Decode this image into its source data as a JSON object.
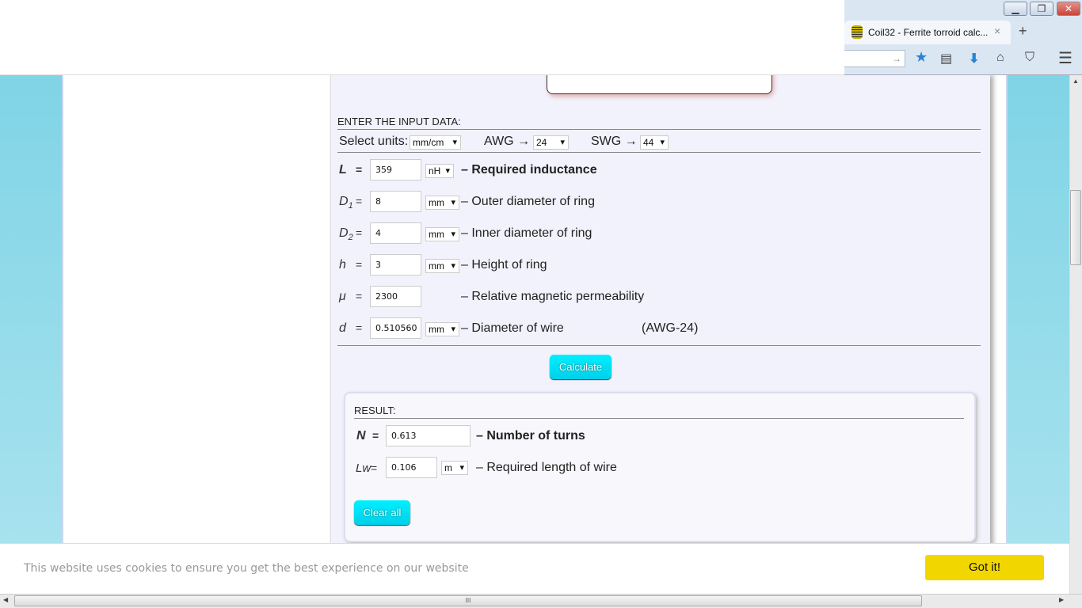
{
  "browser": {
    "tab_title": "Coil32 - Ferrite torroid calc...",
    "tab_close": "×",
    "new_tab": "+",
    "go_arrow": "→",
    "min": "▁",
    "restore": "❐",
    "close": "✕"
  },
  "input": {
    "heading": "ENTER THE INPUT DATA:",
    "select_units_label": "Select units:",
    "units": "mm/cm",
    "awg_label": "AWG →",
    "awg": "24",
    "swg_label": "SWG →",
    "swg": "44",
    "rows": [
      {
        "sym": "L",
        "sub": "",
        "eq": "=",
        "value": "359",
        "unit": "nH",
        "desc": "– Required inductance",
        "bold": true
      },
      {
        "sym": "D",
        "sub": "1",
        "eq": "=",
        "value": "8",
        "unit": "mm",
        "desc": "– Outer diameter of ring"
      },
      {
        "sym": "D",
        "sub": "2",
        "eq": "=",
        "value": "4",
        "unit": "mm",
        "desc": "– Inner diameter of ring"
      },
      {
        "sym": "h",
        "sub": "",
        "eq": "=",
        "value": "3",
        "unit": "mm",
        "desc": "– Height of ring"
      },
      {
        "sym": "μ",
        "sub": "",
        "eq": "=",
        "value": "2300",
        "unit": "",
        "desc": "– Relative magnetic permeability"
      },
      {
        "sym": "d",
        "sub": "",
        "eq": "=",
        "value": "0.510560",
        "unit": "mm",
        "desc": "– Diameter of wire",
        "extra": "(AWG-24)"
      }
    ],
    "calculate": "Calculate"
  },
  "result": {
    "heading": "RESULT:",
    "n_sym": "N",
    "n_eq": "=",
    "n_value": "0.613",
    "n_desc": "– Number of turns",
    "lw_sym": "Lw",
    "lw_eq": "=",
    "lw_value": "0.106",
    "lw_unit": "m",
    "lw_desc": "– Required length of wire",
    "clear": "Clear all"
  },
  "cookie": {
    "text": "This website uses cookies to ensure you get the best experience on our website",
    "button": "Got it!"
  },
  "scroll": {
    "grip": "III"
  }
}
